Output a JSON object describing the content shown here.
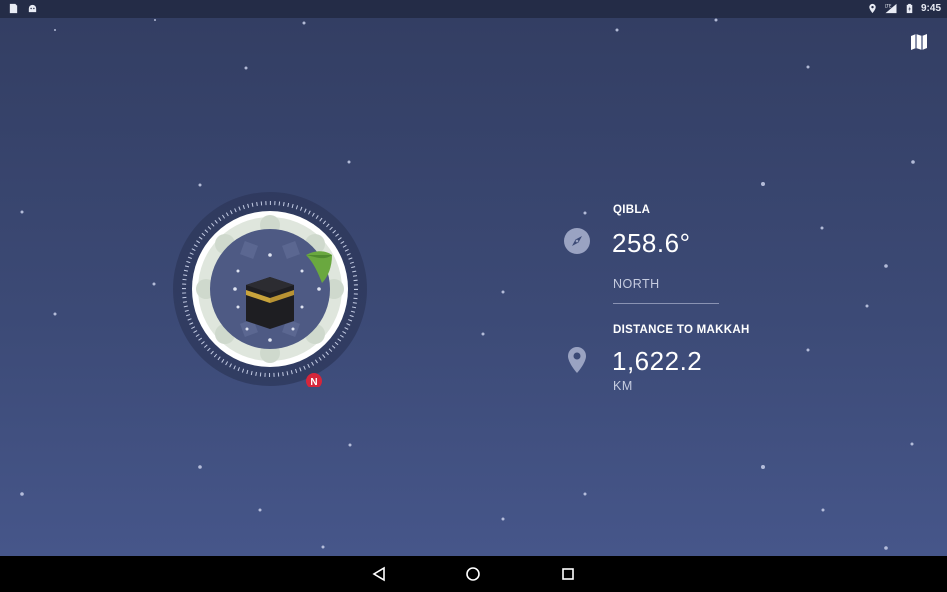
{
  "status_bar": {
    "time": "9:45",
    "network_label": "LTE",
    "left_icons": [
      "notification-file-icon",
      "android-icon"
    ],
    "right_icons": [
      "location-icon",
      "lte-signal-icon",
      "battery-icon"
    ]
  },
  "toolbar": {
    "map_icon": "map-icon"
  },
  "qibla": {
    "label": "QIBLA",
    "value": "258.6°",
    "direction": "NORTH",
    "icon": "compass-icon"
  },
  "distance": {
    "label": "DISTANCE TO MAKKAH",
    "value": "1,622.2",
    "unit": "KM",
    "icon": "location-pin-icon"
  },
  "compass": {
    "north_marker": "N",
    "pointer_icon": "leaf-pointer-icon",
    "center_icon": "kaaba-icon"
  },
  "nav_bar": {
    "buttons": [
      "back-icon",
      "home-icon",
      "recents-icon"
    ]
  },
  "colors": {
    "background_top": "#333e63",
    "background_bottom": "#46568a",
    "accent_red": "#d6263b",
    "leaf_green": "#6aa83f"
  }
}
